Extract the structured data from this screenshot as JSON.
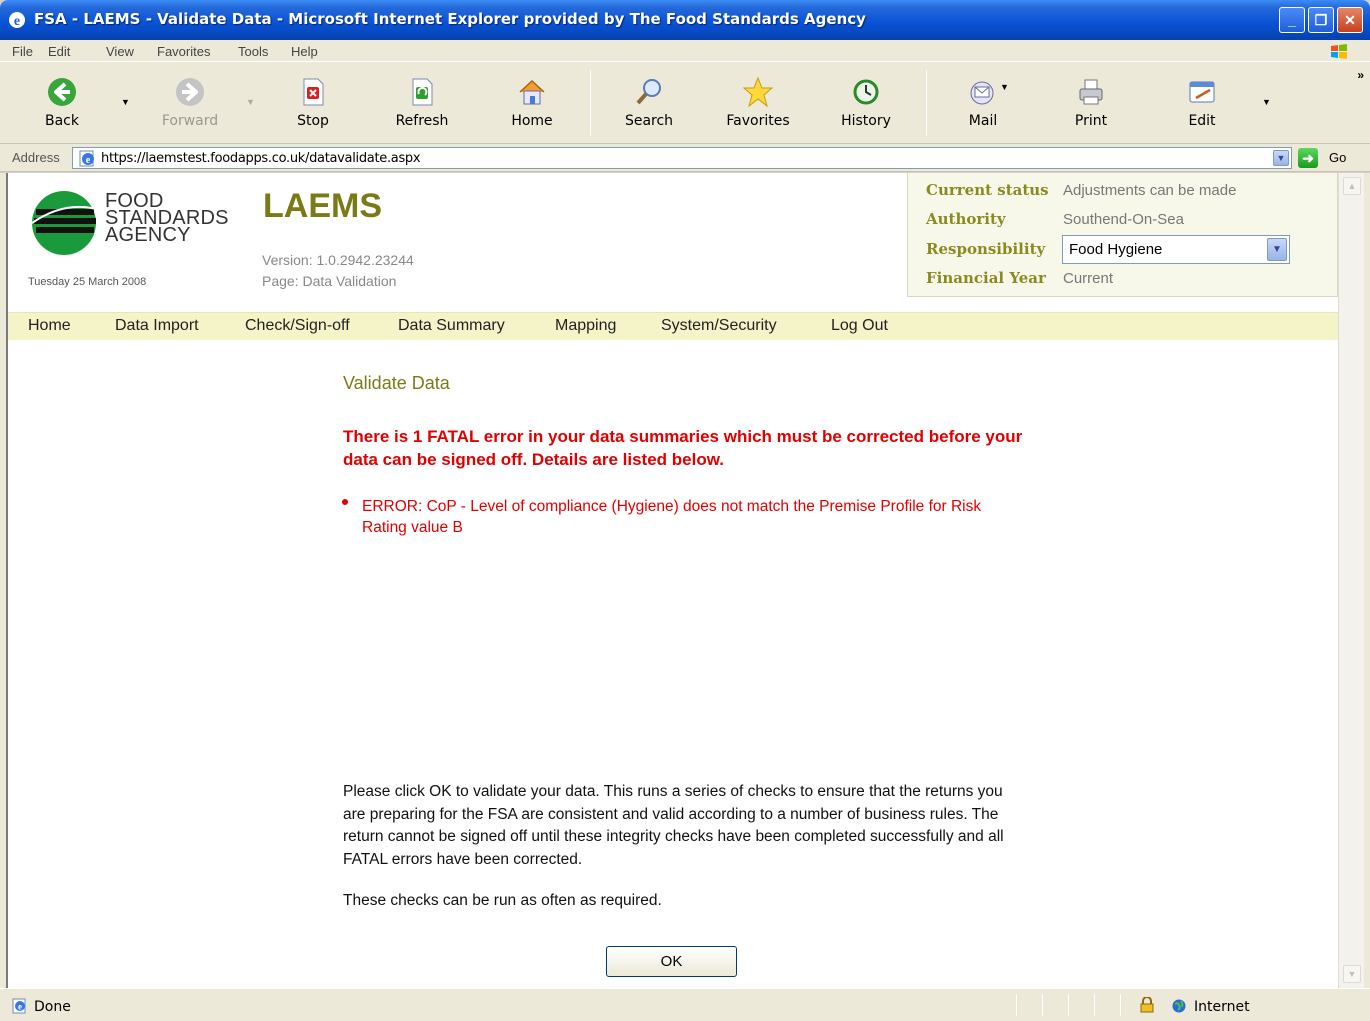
{
  "window": {
    "title": "FSA - LAEMS - Validate Data - Microsoft Internet Explorer provided by The Food Standards Agency"
  },
  "menu": [
    "File",
    "Edit",
    "View",
    "Favorites",
    "Tools",
    "Help"
  ],
  "toolbar": {
    "back": "Back",
    "forward": "Forward",
    "stop": "Stop",
    "refresh": "Refresh",
    "home": "Home",
    "search": "Search",
    "favorites": "Favorites",
    "history": "History",
    "mail": "Mail",
    "print": "Print",
    "edit": "Edit"
  },
  "address": {
    "label": "Address",
    "url": "https://laemstest.foodapps.co.uk/datavalidate.aspx",
    "go": "Go"
  },
  "header": {
    "org_line1": "FOOD",
    "org_line2": "STANDARDS",
    "org_line3": "AGENCY",
    "date": "Tuesday 25 March 2008",
    "app_name": "LAEMS",
    "version": "Version: 1.0.2942.23244",
    "page": "Page: Data Validation"
  },
  "status_panel": {
    "current_status_label": "Current status",
    "current_status_value": "Adjustments can be made",
    "authority_label": "Authority",
    "authority_value": "Southend-On-Sea",
    "responsibility_label": "Responsibility",
    "responsibility_value": "Food Hygiene",
    "financial_year_label": "Financial Year",
    "financial_year_value": "Current"
  },
  "nav": [
    "Home",
    "Data Import",
    "Check/Sign-off",
    "Data Summary",
    "Mapping",
    "System/Security",
    "Log Out"
  ],
  "content": {
    "title": "Validate Data",
    "fatal_message": "There is 1 FATAL error in your data summaries which must be corrected before your data can be signed off. Details are listed below.",
    "errors": [
      "ERROR: CoP - Level of compliance (Hygiene) does not match the Premise Profile for Risk Rating value B"
    ],
    "info": "Please click OK to validate your data. This runs a series of checks to ensure that the returns you are preparing for the FSA are consistent and valid according to a number of business rules. The return cannot be signed off until these integrity checks have been completed successfully and all FATAL errors have been corrected.",
    "info2": "These checks can be run as often as required.",
    "ok_label": "OK"
  },
  "statusbar": {
    "text": "Done",
    "zone": "Internet"
  },
  "colors": {
    "accent": "#7a7a16",
    "error": "#e00000",
    "nav_bg": "#f5f3c8"
  }
}
